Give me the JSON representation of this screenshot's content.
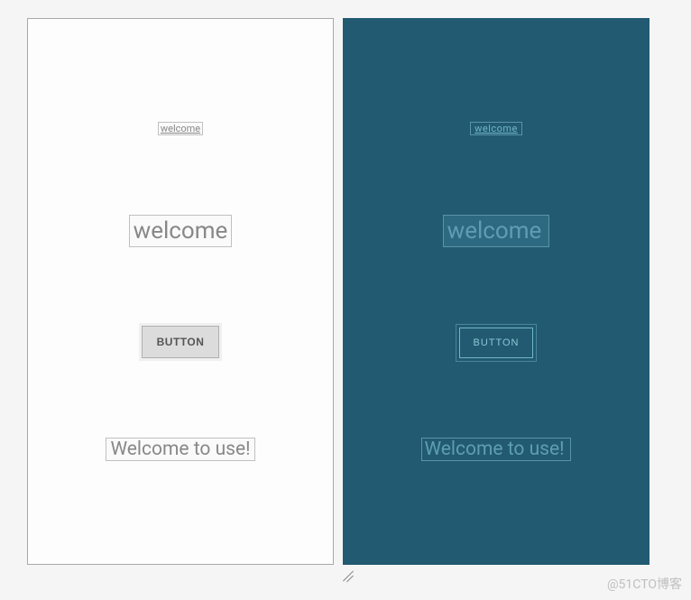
{
  "light": {
    "link_text": "welcome",
    "edittext_value": "welcome",
    "button_label": "BUTTON",
    "textview_text": "Welcome to use!"
  },
  "dark": {
    "link_text": "welcome",
    "edittext_value": "welcome",
    "button_label": "BUTTON",
    "textview_text": "Welcome to use!"
  },
  "watermark": "@51CTO博客"
}
